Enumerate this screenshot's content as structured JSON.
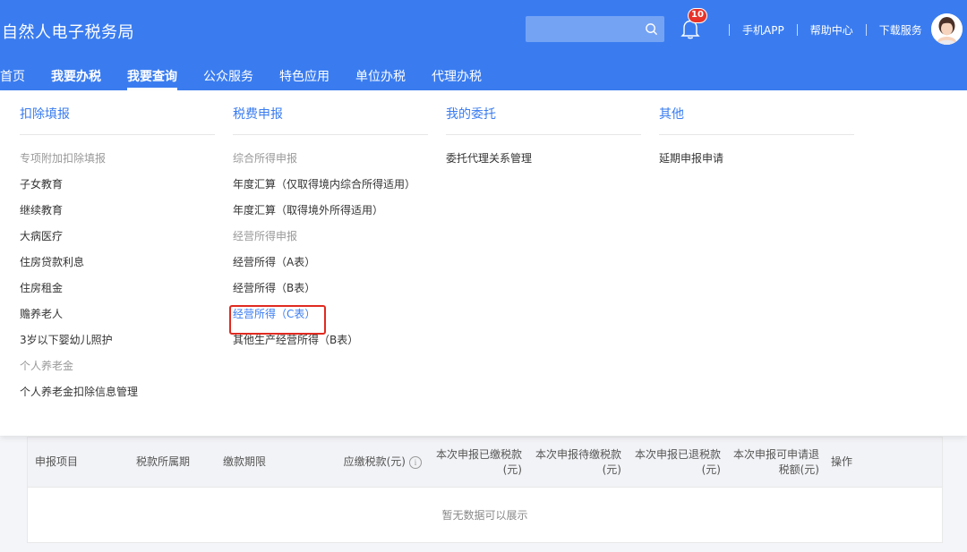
{
  "header": {
    "brand": "自然人电子税务局",
    "search_placeholder": "",
    "notification_count": "10",
    "links": [
      "手机APP",
      "帮助中心",
      "下载服务"
    ]
  },
  "nav": {
    "items": [
      "首页",
      "我要办税",
      "我要查询",
      "公众服务",
      "特色应用",
      "单位办税",
      "代理办税"
    ],
    "active": "我要查询"
  },
  "menu": {
    "col1": {
      "title": "扣除填报",
      "group1": "专项附加扣除填报",
      "items1": [
        "子女教育",
        "继续教育",
        "大病医疗",
        "住房贷款利息",
        "住房租金",
        "赡养老人",
        "3岁以下婴幼儿照护"
      ],
      "group2": "个人养老金",
      "items2": [
        "个人养老金扣除信息管理"
      ]
    },
    "col2": {
      "title": "税费申报",
      "group1": "综合所得申报",
      "items1": [
        "年度汇算（仅取得境内综合所得适用）",
        "年度汇算（取得境外所得适用）"
      ],
      "group2": "经营所得申报",
      "items2": [
        "经营所得（A表）",
        "经营所得（B表）",
        "经营所得（C表）",
        "其他生产经营所得（B表）"
      ],
      "selected": "经营所得（C表）"
    },
    "col3": {
      "title": "我的委托",
      "items": [
        "委托代理关系管理"
      ]
    },
    "col4": {
      "title": "其他",
      "items": [
        "延期申报申请"
      ]
    }
  },
  "table": {
    "columns": [
      "申报项目",
      "税款所属期",
      "缴款期限",
      "应缴税款(元)",
      "本次申报已缴税款(元)",
      "本次申报待缴税款(元)",
      "本次申报已退税款(元)",
      "本次申报可申请退税额(元)",
      "操作"
    ],
    "empty_text": "暂无数据可以展示"
  },
  "colors": {
    "primary": "#3a7cf0",
    "highlight": "#e02a20",
    "badge": "#e8332a"
  }
}
